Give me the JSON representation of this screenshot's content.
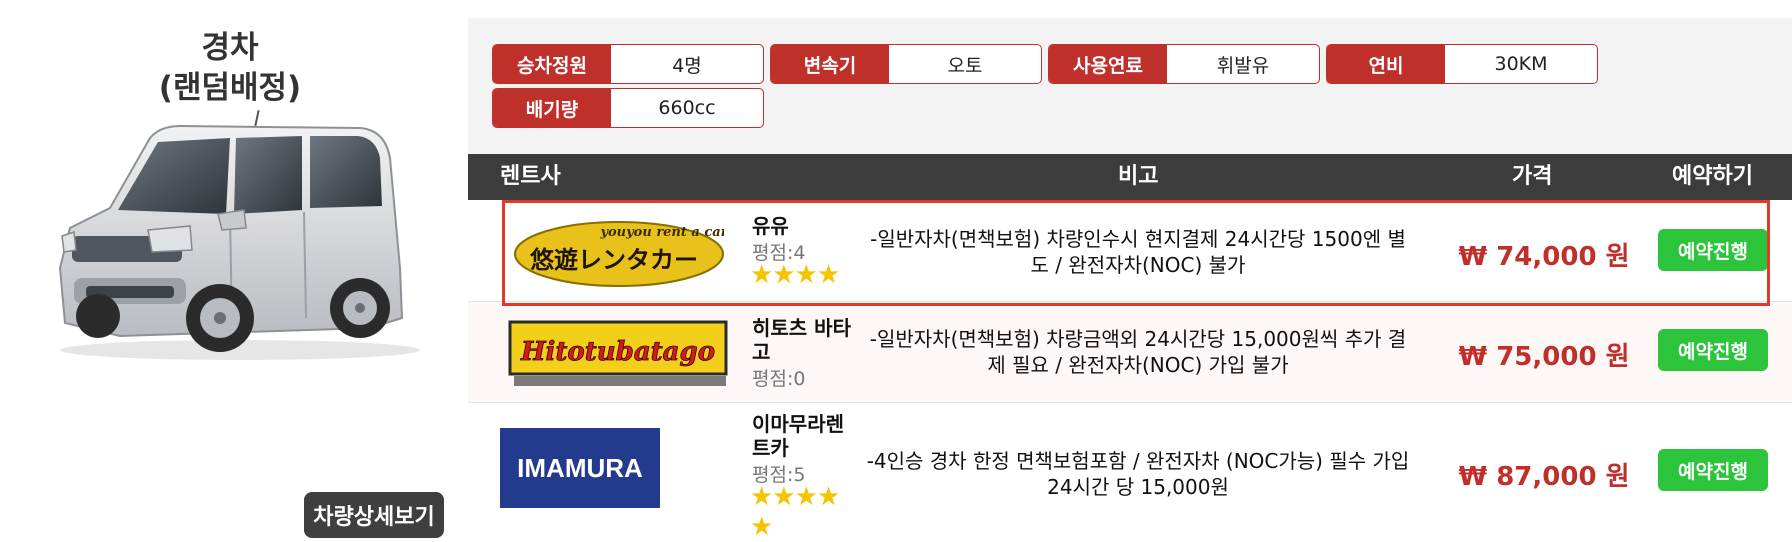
{
  "car": {
    "title_line1": "경차",
    "title_line2": "(랜덤배정)",
    "detail_button": "차량상세보기"
  },
  "specs": [
    {
      "label": "승차정원",
      "value": "4명"
    },
    {
      "label": "변속기",
      "value": "오토"
    },
    {
      "label": "사용연료",
      "value": "휘발유"
    },
    {
      "label": "연비",
      "value": "30KM"
    },
    {
      "label": "배기량",
      "value": "660cc"
    }
  ],
  "table": {
    "headers": {
      "company": "렌트사",
      "note": "비고",
      "price": "가격",
      "reserve": "예약하기"
    },
    "rows": [
      {
        "logo_text": "悠遊レンタカー",
        "logo_subtext": "youyou rent a car",
        "company": "유유",
        "rating": "평점:4",
        "stars": "★★★★",
        "note_line1": "-일반자차(면책보험) 차량인수시 현지결제 24시간당 1500엔 별",
        "note_line2": "도 / 완전자차(NOC) 불가",
        "price": "₩ 74,000 원",
        "button": "예약진행"
      },
      {
        "logo_text": "Hitotubatago",
        "company_line1": "히토츠 바타",
        "company_line2": "고",
        "rating": "평점:0",
        "note_line1": "-일반자차(면책보험) 차량금액외 24시간당 15,000원씩 추가 결",
        "note_line2": "제 필요 / 완전자차(NOC) 가입 불가",
        "price": "₩ 75,000 원",
        "button": "예약진행"
      },
      {
        "logo_text": "IMAMURA",
        "company_line1": "이마무라렌",
        "company_line2": "트카",
        "rating": "평점:5",
        "stars_line1": "★★★★",
        "stars_line2": "★",
        "note_line1": "-4인승 경차 한정 면책보험포함 / 완전자차 (NOC가능) 필수 가입",
        "note_line2": "24시간 당 15,000원",
        "price": "₩ 87,000 원",
        "button": "예약진행"
      }
    ]
  },
  "colors": {
    "accent_red": "#c0302b",
    "button_green": "#2bc43b",
    "header_dark": "#3c3c3c",
    "highlight_border": "#e23a2a"
  }
}
